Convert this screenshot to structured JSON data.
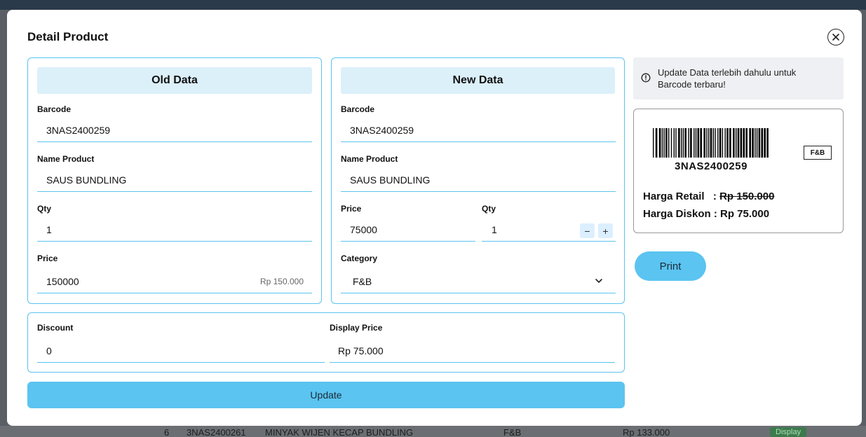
{
  "background": {
    "row_number": "6",
    "row_code": "3NAS2400261",
    "row_name": "MINYAK WIJEN KECAP BUNDLING",
    "row_category": "F&B",
    "row_price": "Rp 133.000",
    "row_badge": "Display"
  },
  "modal": {
    "title": "Detail Product",
    "close_icon": "close-circle-icon"
  },
  "old_data": {
    "heading": "Old Data",
    "barcode_label": "Barcode",
    "barcode_value": "3NAS2400259",
    "name_label": "Name Product",
    "name_value": "SAUS BUNDLING",
    "qty_label": "Qty",
    "qty_value": "1",
    "price_label": "Price",
    "price_value": "150000",
    "price_hint": "Rp 150.000"
  },
  "new_data": {
    "heading": "New Data",
    "barcode_label": "Barcode",
    "barcode_value": "3NAS2400259",
    "name_label": "Name Product",
    "name_value": "SAUS BUNDLING",
    "price_label": "Price",
    "price_value": "75000",
    "qty_label": "Qty",
    "qty_value": "1",
    "minus": "−",
    "plus": "+",
    "category_label": "Category",
    "category_value": "F&B"
  },
  "discount": {
    "discount_label": "Discount",
    "discount_value": "0",
    "display_price_label": "Display Price",
    "display_price_value": "Rp 75.000"
  },
  "update_button": "Update",
  "notice": {
    "icon": "info-circle-icon",
    "text": "Update Data terlebih dahulu untuk Barcode terbaru!"
  },
  "label_preview": {
    "barcode_text": "3NAS2400259",
    "category": "F&B",
    "retail_label": "Harga Retail",
    "retail_sep": ":",
    "retail_value": "Rp 150.000",
    "discount_label": "Harga Diskon",
    "discount_sep": ":",
    "discount_value": "Rp 75.000"
  },
  "print_button": "Print",
  "colors": {
    "accent": "#5bc4f0",
    "header_fill": "#dcf0fa"
  }
}
